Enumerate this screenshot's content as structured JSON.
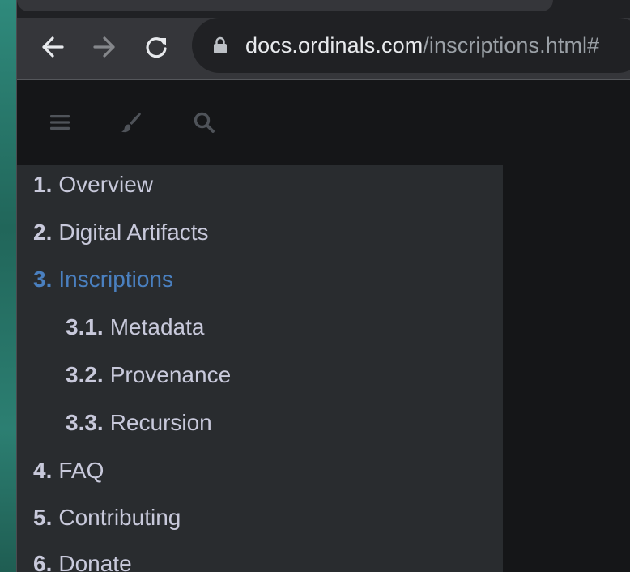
{
  "browser": {
    "url_host": "docs.ordinals.com",
    "url_path": "/inscriptions.html#",
    "icons": {
      "back": "arrow-left-icon",
      "forward": "arrow-right-icon",
      "reload": "reload-icon",
      "lock": "lock-icon"
    }
  },
  "menu_bar": {
    "icons": [
      "hamburger-menu-icon",
      "paintbrush-icon",
      "search-icon"
    ]
  },
  "toc": {
    "items": [
      {
        "num": "1.",
        "label": "Overview",
        "level": 1,
        "active": false
      },
      {
        "num": "2.",
        "label": "Digital Artifacts",
        "level": 1,
        "active": false
      },
      {
        "num": "3.",
        "label": "Inscriptions",
        "level": 1,
        "active": true
      },
      {
        "num": "3.1.",
        "label": "Metadata",
        "level": 2,
        "active": false
      },
      {
        "num": "3.2.",
        "label": "Provenance",
        "level": 2,
        "active": false
      },
      {
        "num": "3.3.",
        "label": "Recursion",
        "level": 2,
        "active": false
      },
      {
        "num": "4.",
        "label": "FAQ",
        "level": 1,
        "active": false
      },
      {
        "num": "5.",
        "label": "Contributing",
        "level": 1,
        "active": false
      },
      {
        "num": "6.",
        "label": "Donate",
        "level": 1,
        "active": false
      }
    ]
  },
  "colors": {
    "active_link": "#4a80c0",
    "link": "#c8c9db",
    "sidebar_bg": "#292c2f",
    "page_bg": "#151618"
  }
}
